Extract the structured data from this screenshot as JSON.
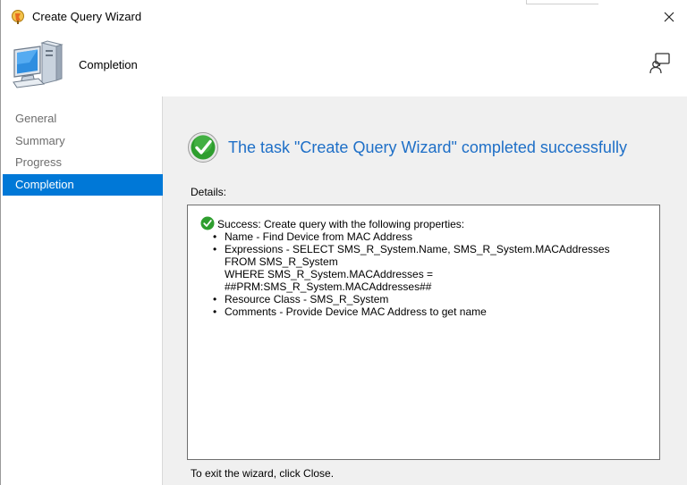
{
  "window": {
    "title": "Create Query Wizard",
    "close_symbol": "✕"
  },
  "header": {
    "page_title": "Completion"
  },
  "nav": {
    "items": [
      {
        "label": "General",
        "active": false
      },
      {
        "label": "Summary",
        "active": false
      },
      {
        "label": "Progress",
        "active": false
      },
      {
        "label": "Completion",
        "active": true
      }
    ]
  },
  "content": {
    "success_message": "The task \"Create Query Wizard\" completed successfully",
    "details_label": "Details:",
    "details": {
      "summary": "Success: Create query with the following properties:",
      "properties": [
        "Name - Find Device from MAC Address",
        "Expressions - SELECT SMS_R_System.Name, SMS_R_System.MACAddresses",
        "Resource Class - SMS_R_System",
        "Comments - Provide Device MAC Address to get name"
      ],
      "expression_continuation": [
        "FROM  SMS_R_System",
        "WHERE SMS_R_System.MACAddresses =",
        "##PRM:SMS_R_System.MACAddresses##"
      ]
    },
    "exit_text": "To exit the wizard, click Close."
  },
  "colors": {
    "accent": "#0078d7",
    "success_text": "#1e6fc7",
    "success_green": "#2e9e2e",
    "content_bg": "#f0f0f0"
  },
  "icons": {
    "app": "wizard-app-icon",
    "header": "computer-icon",
    "help": "help-person-icon",
    "success": "check-circle-icon"
  }
}
